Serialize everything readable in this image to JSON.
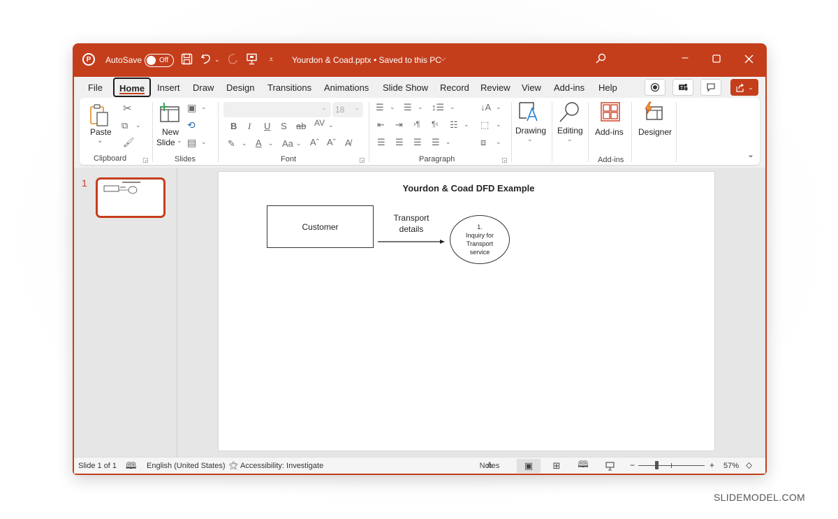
{
  "app": {
    "autosave_label": "AutoSave",
    "autosave_state": "Off",
    "document_title": "Yourdon & Coad.pptx • Saved to this PC",
    "accent_color": "#c43e1c"
  },
  "title_bar_icons": [
    "powerpoint-logo",
    "save-icon",
    "undo-icon",
    "redo-icon",
    "present-icon",
    "customize-quick-access-icon",
    "search-icon",
    "minimize-icon",
    "maximize-icon",
    "close-icon"
  ],
  "tabs": [
    {
      "label": "File"
    },
    {
      "label": "Home",
      "active": true
    },
    {
      "label": "Insert"
    },
    {
      "label": "Draw"
    },
    {
      "label": "Design"
    },
    {
      "label": "Transitions"
    },
    {
      "label": "Animations"
    },
    {
      "label": "Slide Show"
    },
    {
      "label": "Record"
    },
    {
      "label": "Review"
    },
    {
      "label": "View"
    },
    {
      "label": "Add-ins"
    },
    {
      "label": "Help"
    }
  ],
  "ribbon": {
    "clipboard": {
      "paste_label": "Paste",
      "group_label": "Clipboard"
    },
    "slides": {
      "new_slide_label": "New",
      "new_slide_label2": "Slide",
      "group_label": "Slides"
    },
    "font": {
      "font_name": "",
      "font_size": "18",
      "group_label": "Font"
    },
    "paragraph": {
      "group_label": "Paragraph"
    },
    "drawing": {
      "label": "Drawing"
    },
    "editing": {
      "label": "Editing"
    },
    "addins": {
      "label": "Add-ins",
      "group_label": "Add-ins"
    },
    "designer": {
      "label": "Designer"
    }
  },
  "thumbnails": [
    {
      "number": "1"
    }
  ],
  "slide": {
    "title": "Yourdon & Coad DFD Example",
    "entity_label": "Customer",
    "flow_label_line1": "Transport",
    "flow_label_line2": "details",
    "process_number": "1.",
    "process_line1": "Inquiry for",
    "process_line2": "Transport",
    "process_line3": "service"
  },
  "status": {
    "slide_count": "Slide 1 of 1",
    "language": "English (United States)",
    "accessibility": "Accessibility: Investigate",
    "notes_label": "Notes",
    "zoom_percent": "57%",
    "zoom_minus": "−",
    "zoom_plus": "+"
  },
  "watermark": "SLIDEMODEL.COM"
}
